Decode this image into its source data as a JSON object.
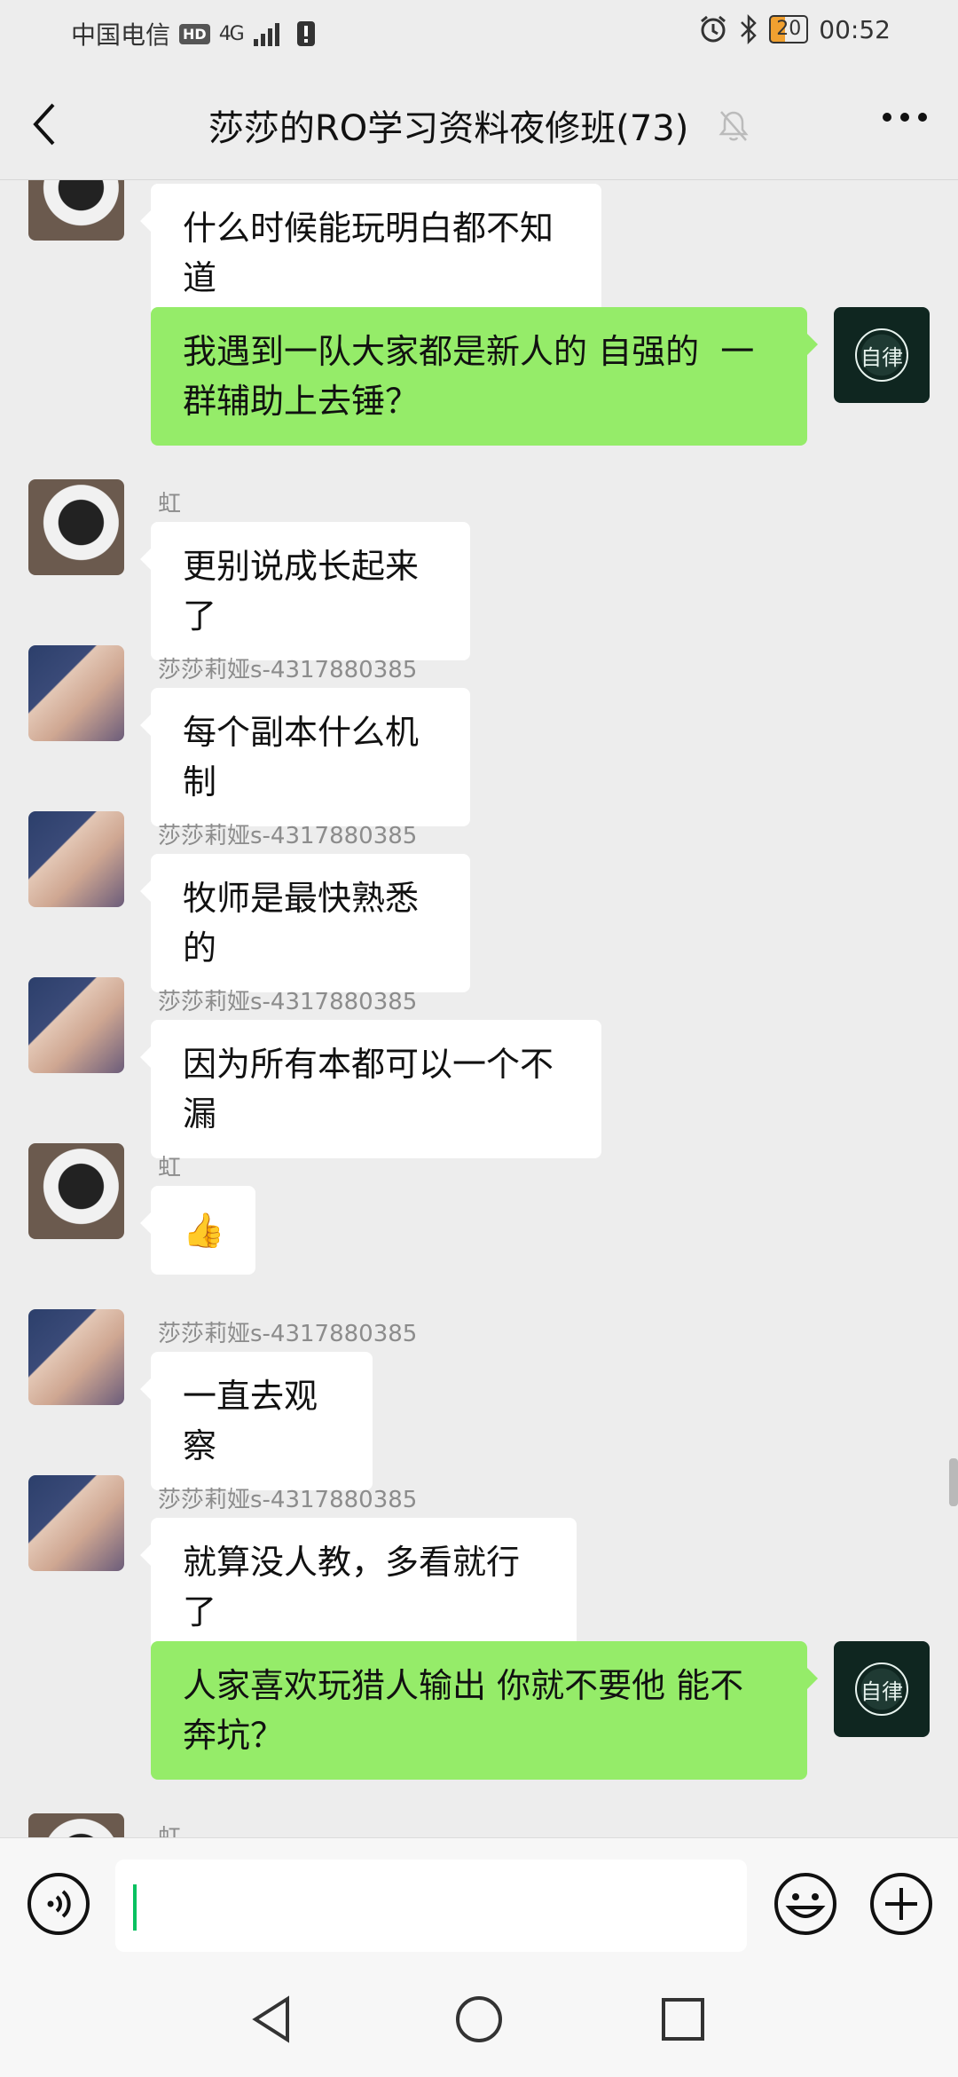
{
  "status_bar": {
    "carrier": "中国电信",
    "hd": "HD",
    "network": "4G",
    "battery": "20",
    "time": "00:52"
  },
  "nav": {
    "title": "莎莎的RO学习资料夜修班(73)"
  },
  "self_avatar_text": "自律",
  "messages": [
    {
      "side": "in",
      "avatar": "cat",
      "sender": "",
      "text": "什么时候能玩明白都不知道"
    },
    {
      "side": "out",
      "avatar": "self",
      "text": "我遇到一队大家都是新人的 自强的  一群辅助上去锤？"
    },
    {
      "side": "in",
      "avatar": "cat",
      "sender": "虹",
      "text": "更别说成长起来了"
    },
    {
      "side": "in",
      "avatar": "girl",
      "sender": "莎莎莉娅s-4317880385",
      "text": "每个副本什么机制"
    },
    {
      "side": "in",
      "avatar": "girl",
      "sender": "莎莎莉娅s-4317880385",
      "text": "牧师是最快熟悉的"
    },
    {
      "side": "in",
      "avatar": "girl",
      "sender": "莎莎莉娅s-4317880385",
      "text": "因为所有本都可以一个不漏"
    },
    {
      "side": "in",
      "avatar": "cat",
      "sender": "虹",
      "text": "👍"
    },
    {
      "side": "in",
      "avatar": "girl",
      "sender": "莎莎莉娅s-4317880385",
      "text": "一直去观察"
    },
    {
      "side": "in",
      "avatar": "girl",
      "sender": "莎莎莉娅s-4317880385",
      "text": "就算没人教，多看就行了"
    },
    {
      "side": "out",
      "avatar": "self",
      "text": "人家喜欢玩猎人输出 你就不要他 能不奔坑？"
    },
    {
      "side": "in",
      "avatar": "cat",
      "sender": "虹",
      "text": ""
    }
  ],
  "colors": {
    "background": "#ededed",
    "bubble_out": "#95ec69",
    "bubble_in": "#ffffff",
    "caret": "#07c160"
  },
  "icons": {
    "back": "chevron-left-icon",
    "mute": "bell-off-icon",
    "more": "more-dots-icon",
    "voice": "voice-icon",
    "emoji": "emoji-icon",
    "plus": "plus-icon"
  }
}
